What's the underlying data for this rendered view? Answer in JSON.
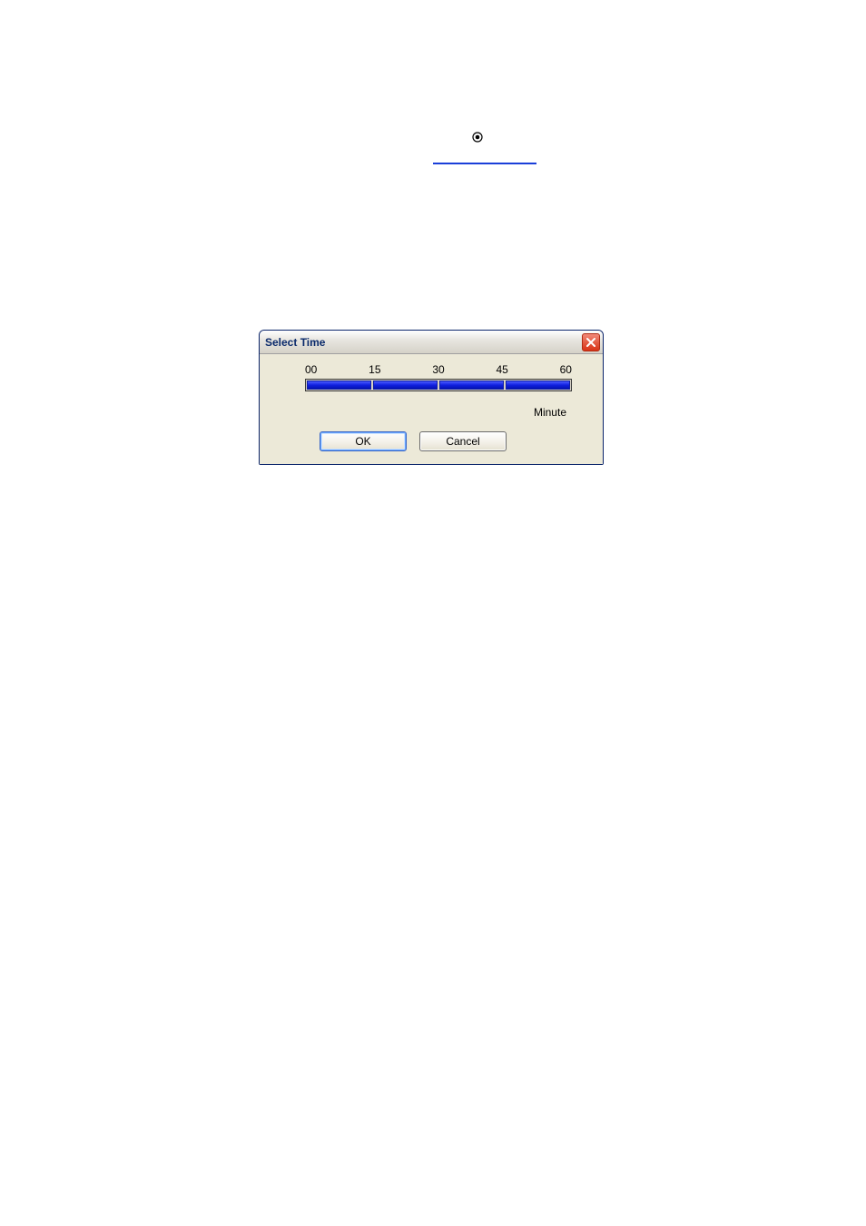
{
  "decor": {
    "radio_icon": "radio-selected"
  },
  "dialog": {
    "title": "Select Time",
    "ticks": [
      "00",
      "15",
      "30",
      "45",
      "60"
    ],
    "unit_label": "Minute",
    "buttons": {
      "ok": "OK",
      "cancel": "Cancel"
    }
  }
}
